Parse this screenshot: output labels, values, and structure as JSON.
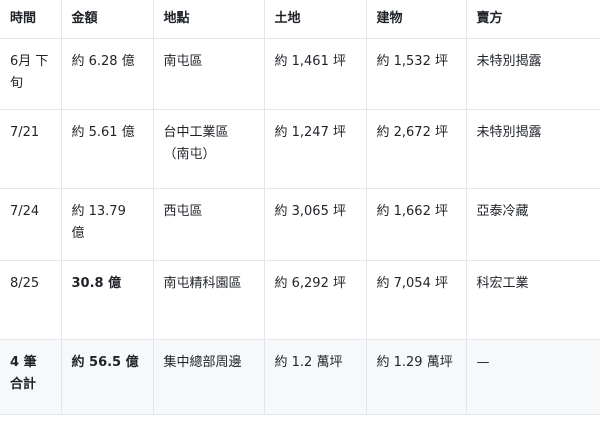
{
  "headers": [
    "時間",
    "金額",
    "地點",
    "土地",
    "建物",
    "賣方"
  ],
  "rows": [
    [
      "6月 下旬",
      "約 6.28 億",
      "南屯區",
      "約 1,461 坪",
      "約 1,532 坪",
      "未特別揭露"
    ],
    [
      "7/21",
      "約 5.61 億",
      "台中工業區（南屯）",
      "約 1,247 坪",
      "約 2,672 坪",
      "未特別揭露"
    ],
    [
      "7/24",
      "約 13.79 億",
      "西屯區",
      "約 3,065 坪",
      "約 1,662 坪",
      "亞泰冷藏"
    ],
    [
      "8/25",
      "30.8 億",
      "南屯精科園區",
      "約 6,292 坪",
      "約 7,054 坪",
      "科宏工業"
    ],
    [
      "4 筆 合計",
      "約 56.5 億",
      "集中總部周邊",
      "約 1.2 萬坪",
      "約 1.29 萬坪",
      "—"
    ]
  ]
}
